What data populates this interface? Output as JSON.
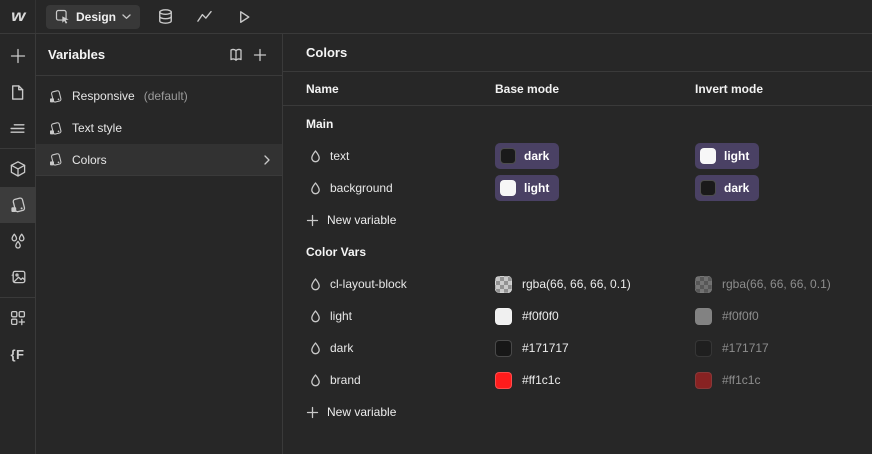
{
  "topbar": {
    "design_label": "Design",
    "icons": [
      "select-cursor-icon",
      "cms-database-icon",
      "analytics-icon",
      "preview-play-icon"
    ]
  },
  "rail": {
    "finsweet_label": "{F",
    "items": [
      "add-element",
      "pages",
      "navigator",
      "components",
      "variables",
      "styles",
      "assets",
      "apps",
      "finsweet"
    ]
  },
  "variables_panel": {
    "title": "Variables",
    "icons": [
      "library-book-icon",
      "add-collection-icon"
    ],
    "items": [
      {
        "label": "Responsive",
        "suffix": "(default)"
      },
      {
        "label": "Text style",
        "suffix": ""
      },
      {
        "label": "Colors",
        "suffix": ""
      }
    ]
  },
  "main": {
    "title": "Colors",
    "columns": [
      "Name",
      "Base mode",
      "Invert mode"
    ],
    "sections": [
      {
        "label": "Main",
        "rows": [
          {
            "name": "text",
            "base": {
              "swatch": "#1a1a1a",
              "label": "dark"
            },
            "invert": {
              "swatch": "#f7f7f7",
              "label": "light"
            }
          },
          {
            "name": "background",
            "base": {
              "swatch": "#f7f7f7",
              "label": "light"
            },
            "invert": {
              "swatch": "#1a1a1a",
              "label": "dark"
            }
          }
        ],
        "new_variable_label": "New variable"
      },
      {
        "label": "Color Vars",
        "rows": [
          {
            "name": "cl-layout-block",
            "base": {
              "swatch": "checker",
              "value": "rgba(66, 66, 66, 0.1)"
            },
            "invert": {
              "swatch": "checker",
              "value": "rgba(66, 66, 66, 0.1)"
            }
          },
          {
            "name": "light",
            "base": {
              "swatch": "#f0f0f0",
              "value": "#f0f0f0"
            },
            "invert": {
              "swatch": "#f0f0f0",
              "value": "#f0f0f0"
            }
          },
          {
            "name": "dark",
            "base": {
              "swatch": "#171717",
              "value": "#171717"
            },
            "invert": {
              "swatch": "#171717",
              "value": "#171717"
            }
          },
          {
            "name": "brand",
            "base": {
              "swatch": "#ff1c1c",
              "value": "#ff1c1c"
            },
            "invert": {
              "swatch": "#ff1c1c",
              "value": "#ff1c1c"
            }
          }
        ],
        "new_variable_label": "New variable"
      }
    ]
  },
  "ui": {
    "pill_bg": "#4a4164",
    "selected_row_bg": "#323232",
    "brand_red": "#ff1c1c",
    "panel_bg": "#272727"
  }
}
